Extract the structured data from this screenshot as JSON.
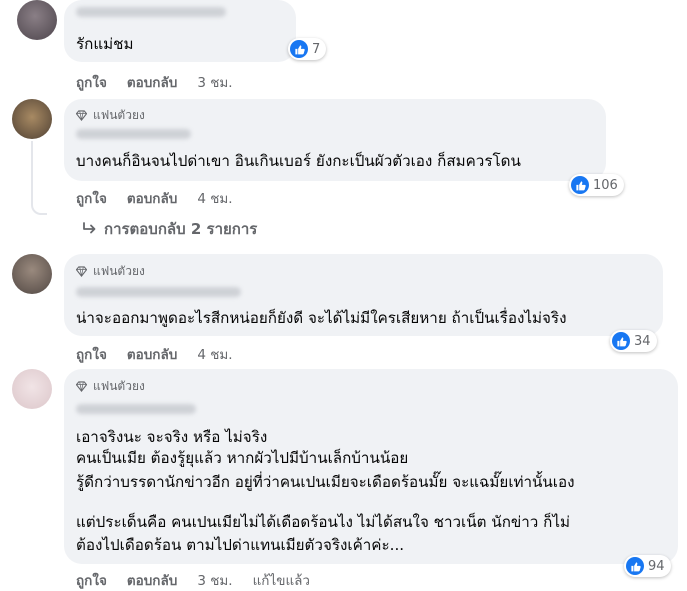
{
  "badge_label": "แฟนตัวยง",
  "actions": {
    "like": "ถูกใจ",
    "reply": "ตอบกลับ"
  },
  "comments": [
    {
      "text_lines": [
        "รักแม่ชม"
      ],
      "reactions": "7",
      "time": "3 ชม.",
      "edited": ""
    },
    {
      "text_lines": [
        "บางคนก็อินจนไปด่าเขา อินเกินเบอร์ ยังกะเป็นผัวตัวเอง ก็สมควรโดน"
      ],
      "reactions": "106",
      "time": "4 ชม.",
      "edited": "",
      "view_replies": "การตอบกลับ 2 รายการ"
    },
    {
      "text_lines": [
        "น่าจะออกมาพูดอะไรสีกหน่อยก็ยังดี จะได้ไม่มีใครเสียหาย ถ้าเป็นเรื่องไม่จริง"
      ],
      "reactions": "34",
      "time": "4 ชม.",
      "edited": ""
    },
    {
      "text_lines": [
        "เอาจริงนะ จะจริง หรือ ไม่จริง",
        "คนเป็นเมีย ต้องรู้ยุแล้ว หากผัวไปมีบ้านเล็กบ้านน้อย",
        "รู้ดีกว่าบรรดานักข่าวอีก อยู่ที่ว่าคนเปนเมียจะเดือดร้อนมั๊ย จะแฉมั๊ยเท่านั้นเอง",
        "แต่ประเด็นคือ คนเปนเมียไม่ได้เดือดร้อนไง ไม่ได้สนใจ ชาวเน็ต นักข่าว ก็ไม่",
        "ต้องไปเดือดร้อน ตามไปด่าแทนเมียตัวจริงเค้าค่ะ..."
      ],
      "reactions": "94",
      "time": "3 ชม.",
      "edited": "แก้ไขแล้ว"
    }
  ],
  "colors": {
    "like_blue": "#1877f2",
    "bubble": "#f0f2f5",
    "meta": "#65676b"
  }
}
